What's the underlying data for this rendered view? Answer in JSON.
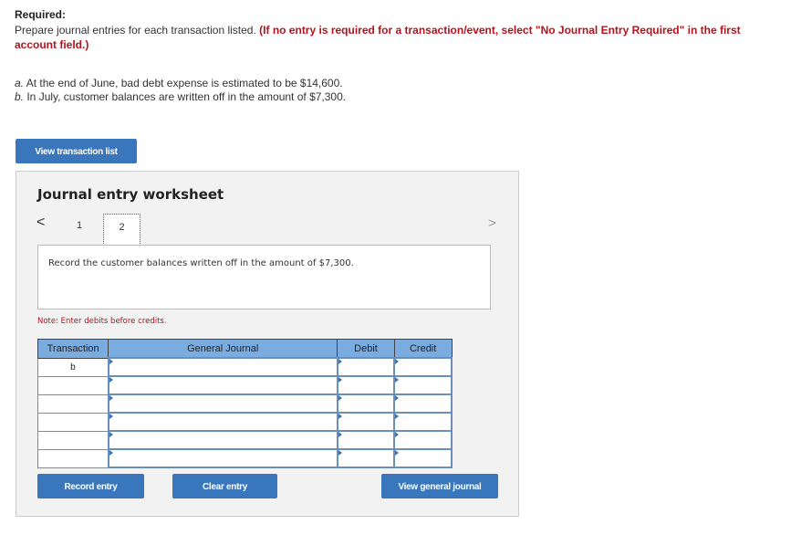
{
  "header": {
    "required_label": "Required:",
    "instruction_plain": "Prepare journal entries for each transaction listed. ",
    "instruction_red": "(If no entry is required for a transaction/event, select \"No Journal Entry Required\" in the first account field.)"
  },
  "problems": [
    {
      "letter": "a.",
      "text": " At the end of June, bad debt expense is estimated to be $14,600."
    },
    {
      "letter": "b.",
      "text": " In July, customer balances are written off in the amount of $7,300."
    }
  ],
  "view_transaction_list": "View transaction list",
  "worksheet": {
    "title": "Journal entry worksheet",
    "pages": [
      "1",
      "2"
    ],
    "current_page": "2",
    "prev_icon": "<",
    "next_icon": ">",
    "description": "Record the customer balances written off in the amount of $7,300.",
    "note": "Note: Enter debits before credits.",
    "columns": [
      "Transaction",
      "General Journal",
      "Debit",
      "Credit"
    ],
    "rows": [
      {
        "transaction": "b",
        "account": "",
        "debit": "",
        "credit": ""
      },
      {
        "transaction": "",
        "account": "",
        "debit": "",
        "credit": ""
      },
      {
        "transaction": "",
        "account": "",
        "debit": "",
        "credit": ""
      },
      {
        "transaction": "",
        "account": "",
        "debit": "",
        "credit": ""
      },
      {
        "transaction": "",
        "account": "",
        "debit": "",
        "credit": ""
      },
      {
        "transaction": "",
        "account": "",
        "debit": "",
        "credit": ""
      }
    ],
    "buttons": {
      "record": "Record entry",
      "clear": "Clear entry",
      "view_general_journal": "View general journal"
    }
  }
}
